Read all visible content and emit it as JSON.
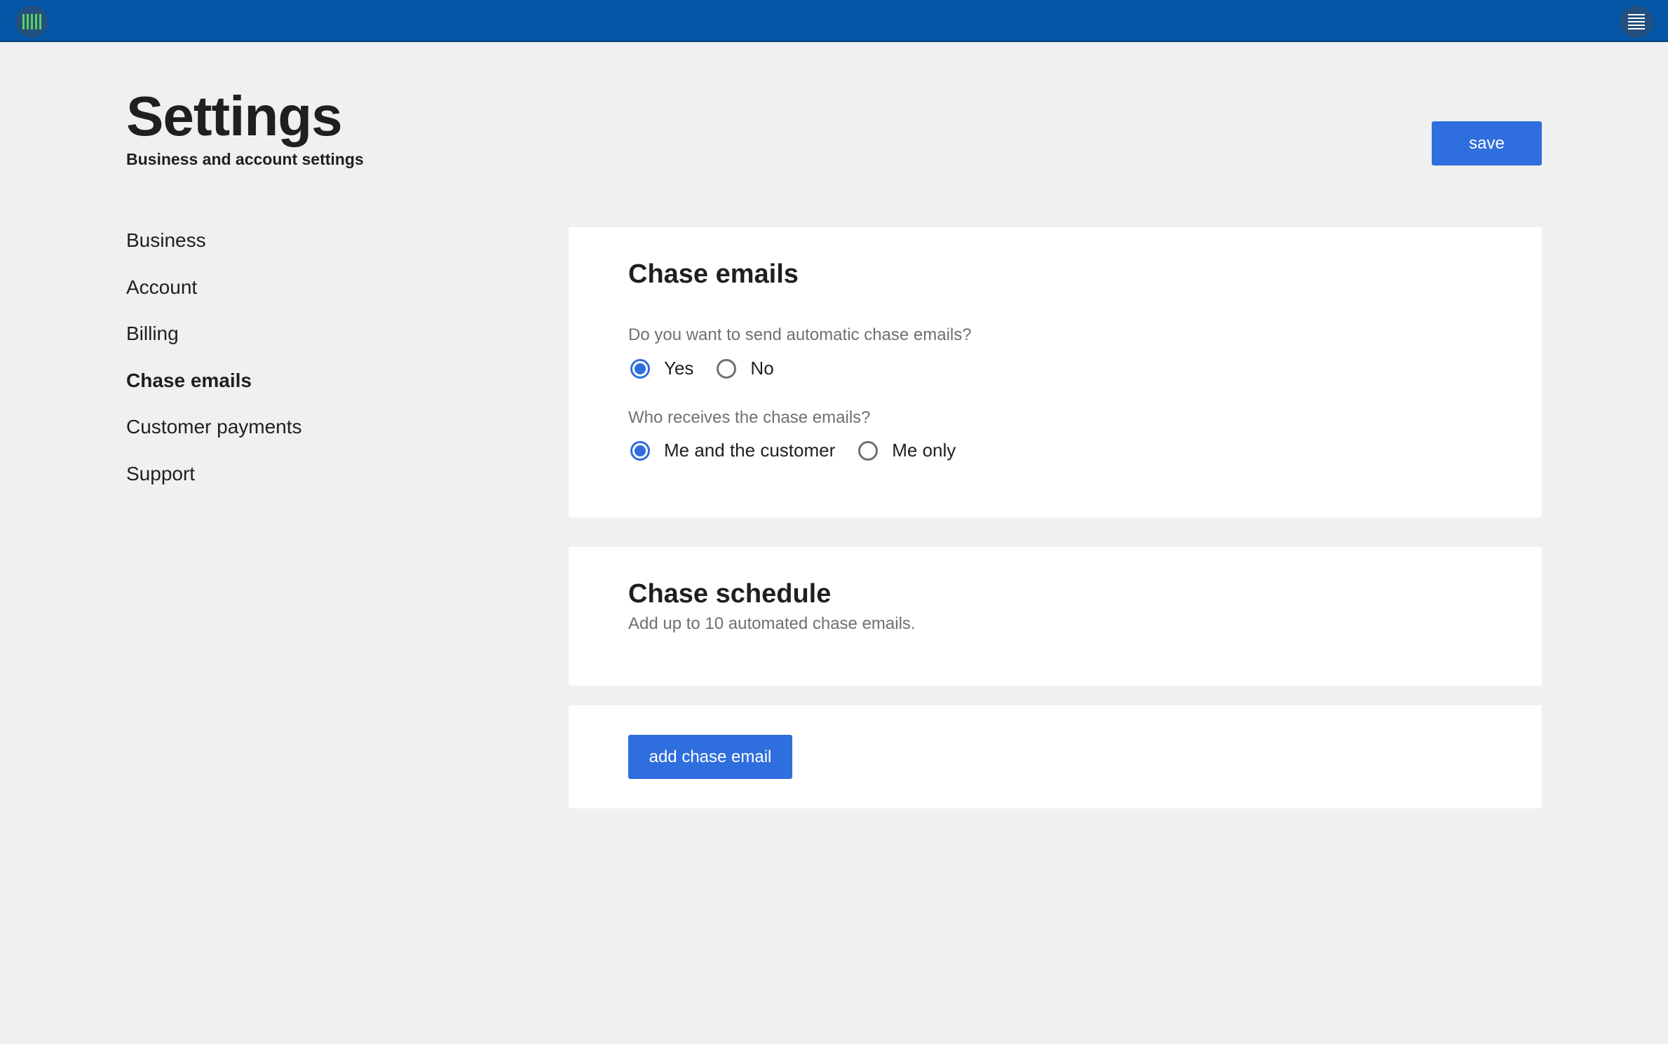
{
  "header": {
    "logo_icon": "barcode-logo-icon",
    "menu_icon": "menu-icon",
    "bar_color": "#0256a5"
  },
  "page": {
    "title": "Settings",
    "subtitle": "Business and account settings",
    "save_label": "save"
  },
  "sidebar": {
    "items": [
      {
        "label": "Business",
        "active": false
      },
      {
        "label": "Account",
        "active": false
      },
      {
        "label": "Billing",
        "active": false
      },
      {
        "label": "Chase emails",
        "active": true
      },
      {
        "label": "Customer payments",
        "active": false
      },
      {
        "label": "Support",
        "active": false
      }
    ]
  },
  "chase_emails": {
    "title": "Chase emails",
    "send_question": "Do you want to send automatic chase emails?",
    "send_options": [
      {
        "label": "Yes",
        "selected": true
      },
      {
        "label": "No",
        "selected": false
      }
    ],
    "recipient_question": "Who receives the chase emails?",
    "recipient_options": [
      {
        "label": "Me and the customer",
        "selected": true
      },
      {
        "label": "Me only",
        "selected": false
      }
    ]
  },
  "chase_schedule": {
    "title": "Chase schedule",
    "description": "Add up to 10 automated chase emails.",
    "add_label": "add chase email"
  },
  "colors": {
    "accent": "#2f6ede",
    "background": "#f0f0f0",
    "muted_text": "#707070"
  }
}
